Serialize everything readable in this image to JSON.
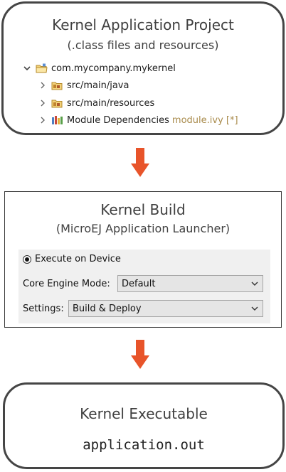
{
  "project": {
    "title": "Kernel Application Project",
    "subtitle": "(.class files and resources)",
    "tree": {
      "root": "com.mycompany.mykernel",
      "children": [
        {
          "label": "src/main/java",
          "decoration": ""
        },
        {
          "label": "src/main/resources",
          "decoration": ""
        },
        {
          "label": "Module Dependencies",
          "decoration": "module.ivy [*]"
        }
      ]
    }
  },
  "build": {
    "title": "Kernel Build",
    "subtitle": "(MicroEJ Application Launcher)",
    "launcher": {
      "radio_label": "Execute on Device",
      "core_engine_label": "Core Engine Mode:",
      "core_engine_value": "Default",
      "settings_label": "Settings:",
      "settings_value": "Build & Deploy"
    }
  },
  "executable": {
    "title": "Kernel Executable",
    "filename": "application.out"
  },
  "colors": {
    "arrow": "#e8542a",
    "box_border": "#454545",
    "decoration_text": "#a98b4c",
    "panel_bg": "#f0f0f0"
  },
  "icons": {
    "expanded": "chevron-down-icon",
    "collapsed": "chevron-right-icon",
    "project": "project-folder-icon",
    "source_folder": "source-folder-icon",
    "library": "library-icon",
    "dropdown": "dropdown-arrow-icon",
    "flow_arrow": "down-arrow-icon"
  }
}
